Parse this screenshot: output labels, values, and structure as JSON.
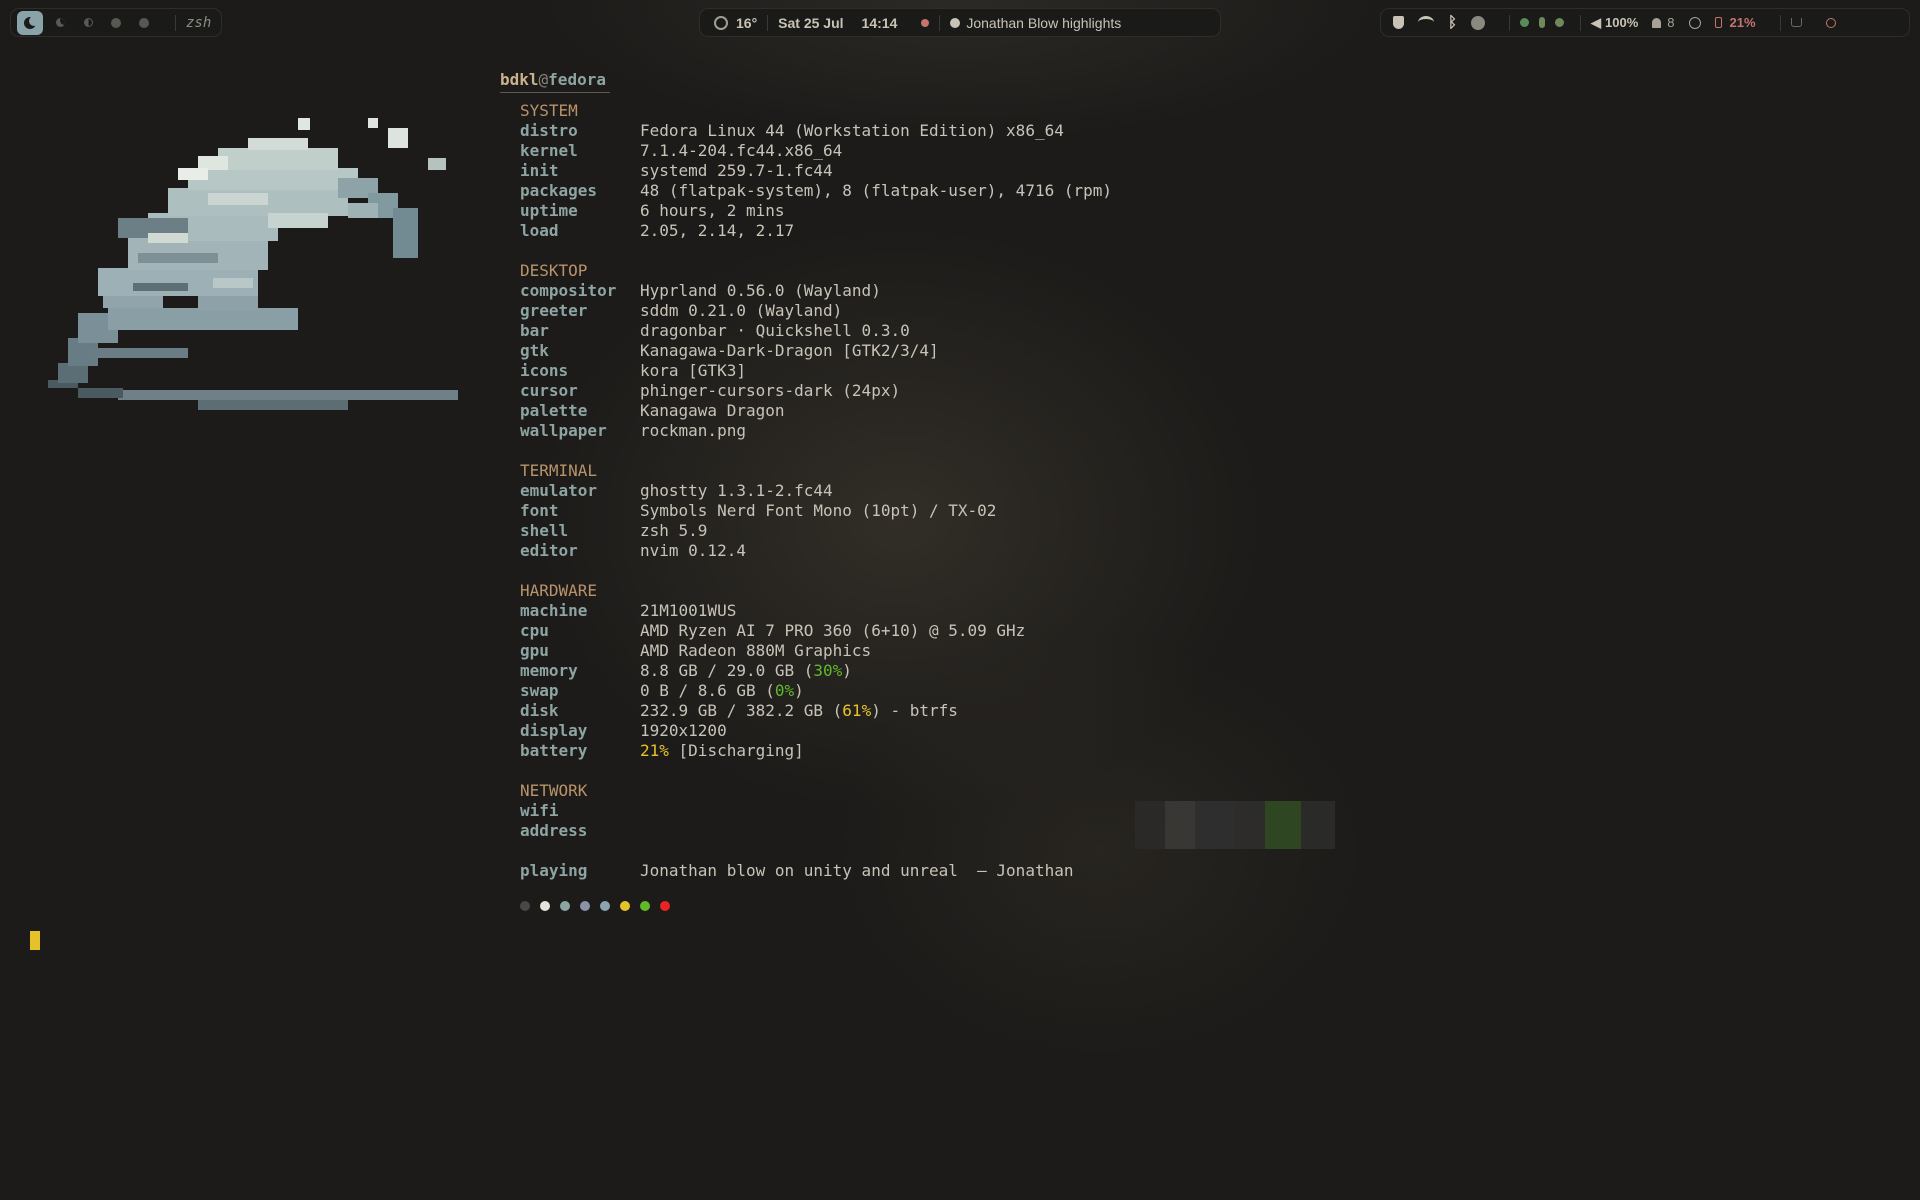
{
  "topbar": {
    "workspaces": [
      {
        "icon": "moon-icon",
        "active": true
      },
      {
        "icon": "crescent-icon",
        "active": false
      },
      {
        "icon": "half-moon-icon",
        "active": false
      },
      {
        "icon": "circle-icon",
        "active": false
      },
      {
        "icon": "circle-icon",
        "active": false
      }
    ],
    "window_title": "zsh",
    "weather": "16°",
    "date": "Sat 25 Jul",
    "time": "14:14",
    "media_title": "Jonathan Blow highlights",
    "volume": "100%",
    "notifications": "8",
    "battery": "21%",
    "colors": {
      "accent": "#8aa3a8",
      "record": "#c4746e",
      "battery": "#c4746e"
    }
  },
  "fetch": {
    "user": "bdkl",
    "at": "@",
    "host": "fedora",
    "system": {
      "heading": "SYSTEM",
      "rows": [
        {
          "k": "distro",
          "v": "Fedora Linux 44 (Workstation Edition) x86_64"
        },
        {
          "k": "kernel",
          "v": "7.1.4-204.fc44.x86_64"
        },
        {
          "k": "init",
          "v": "systemd 259.7-1.fc44"
        },
        {
          "k": "packages",
          "v": "48 (flatpak-system), 8 (flatpak-user), 4716 (rpm)"
        },
        {
          "k": "uptime",
          "v": "6 hours, 2 mins"
        },
        {
          "k": "load",
          "v": "2.05, 2.14, 2.17"
        }
      ]
    },
    "desktop": {
      "heading": "DESKTOP",
      "rows": [
        {
          "k": "compositor",
          "v": "Hyprland 0.56.0 (Wayland)"
        },
        {
          "k": "greeter",
          "v": "sddm 0.21.0 (Wayland)"
        },
        {
          "k": "bar",
          "v": "dragonbar · Quickshell 0.3.0"
        },
        {
          "k": "gtk",
          "v": "Kanagawa-Dark-Dragon [GTK2/3/4]"
        },
        {
          "k": "icons",
          "v": "kora [GTK3]"
        },
        {
          "k": "cursor",
          "v": "phinger-cursors-dark (24px)"
        },
        {
          "k": "palette",
          "v": "Kanagawa Dragon"
        },
        {
          "k": "wallpaper",
          "v": "rockman.png"
        }
      ]
    },
    "terminal": {
      "heading": "TERMINAL",
      "rows": [
        {
          "k": "emulator",
          "v": "ghostty 1.3.1-2.fc44"
        },
        {
          "k": "font",
          "v": "Symbols Nerd Font Mono (10pt) / TX-02"
        },
        {
          "k": "shell",
          "v": "zsh 5.9"
        },
        {
          "k": "editor",
          "v": "nvim 0.12.4"
        }
      ]
    },
    "hardware": {
      "heading": "HARDWARE",
      "machine": {
        "k": "machine",
        "v": "21M1001WUS"
      },
      "cpu": {
        "k": "cpu",
        "v": "AMD Ryzen AI 7 PRO 360 (6+10) @ 5.09 GHz"
      },
      "gpu": {
        "k": "gpu",
        "v": "AMD Radeon 880M Graphics"
      },
      "memory": {
        "k": "memory",
        "pre": "8.8 GB / 29.0 GB (",
        "pct": "30%",
        "post": ")"
      },
      "swap": {
        "k": "swap",
        "pre": "0 B / 8.6 GB (",
        "pct": "0%",
        "post": ")"
      },
      "disk": {
        "k": "disk",
        "pre": "232.9 GB / 382.2 GB (",
        "pct": "61%",
        "post": ") - btrfs"
      },
      "display": {
        "k": "display",
        "v": "1920x1200"
      },
      "battery": {
        "k": "battery",
        "pct": "21%",
        "post": " [Discharging]"
      }
    },
    "network": {
      "heading": "NETWORK",
      "wifi_key": "wifi",
      "address_key": "address"
    },
    "playing": {
      "k": "playing",
      "v": "Jonathan blow on unity and unreal  — Jonathan"
    },
    "palette_dots": [
      "#4a4845",
      "#e8e4dc",
      "#8ea4a2",
      "#8992a7",
      "#8ba4b0",
      "#e6c229",
      "#5fba2a",
      "#e82424"
    ]
  }
}
